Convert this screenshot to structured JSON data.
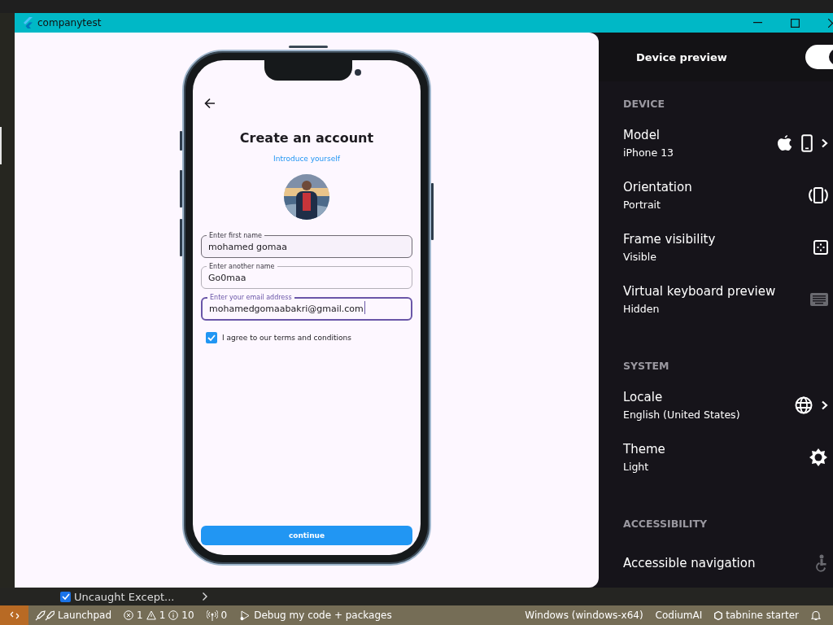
{
  "window": {
    "title": "companytest"
  },
  "app": {
    "title": "Create an account",
    "subtitle": "Introduce yourself",
    "fields": [
      {
        "label": "Enter first name",
        "value": "mohamed gomaa",
        "hovered": true,
        "focused": false
      },
      {
        "label": "Enter another name",
        "value": "Go0maa",
        "hovered": false,
        "focused": false
      },
      {
        "label": "Enter your email address",
        "value": "mohamedgomaabakri@gmail.com",
        "hovered": false,
        "focused": true
      }
    ],
    "terms": {
      "label": "I agree to our terms and conditions",
      "checked": true
    },
    "continue_button": "continue"
  },
  "device_preview": {
    "title": "Device preview",
    "enabled": true,
    "sections": [
      {
        "heading": "DEVICE",
        "items": [
          {
            "kind": "model",
            "label": "Model",
            "value": "iPhone 13",
            "chevron": true
          },
          {
            "kind": "orientation",
            "label": "Orientation",
            "value": "Portrait",
            "chevron": false
          },
          {
            "kind": "frame",
            "label": "Frame visibility",
            "value": "Visible",
            "chevron": false
          },
          {
            "kind": "keyboard",
            "label": "Virtual keyboard preview",
            "value": "Hidden",
            "chevron": false
          }
        ]
      },
      {
        "heading": "SYSTEM",
        "items": [
          {
            "kind": "locale",
            "label": "Locale",
            "value": "English (United States)",
            "chevron": true
          },
          {
            "kind": "theme",
            "label": "Theme",
            "value": "Light",
            "chevron": false
          }
        ]
      },
      {
        "heading": "ACCESSIBILITY",
        "items": [
          {
            "kind": "accessibility",
            "label": "Accessible navigation",
            "chevron": false
          }
        ]
      }
    ]
  },
  "bottom_panel": {
    "exception_filter": {
      "label": "Uncaught Except...",
      "checked": true
    }
  },
  "status_bar": {
    "left": [
      {
        "kind": "launchpad",
        "text": "Launchpad"
      },
      {
        "kind": "problems",
        "errors": "1",
        "warnings": "1",
        "infos": "10"
      },
      {
        "kind": "ports",
        "text": "0"
      },
      {
        "kind": "debug",
        "text": "Debug my code + packages"
      }
    ],
    "right": [
      {
        "kind": "platform",
        "text": "Windows (windows-x64)"
      },
      {
        "kind": "codium",
        "text": "CodiumAI"
      },
      {
        "kind": "tabnine",
        "text": "tabnine starter"
      },
      {
        "kind": "bell"
      }
    ]
  }
}
